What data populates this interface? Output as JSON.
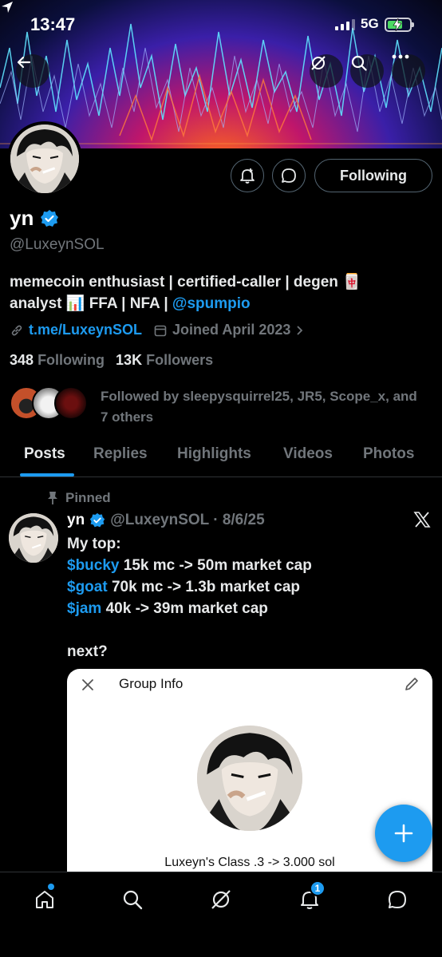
{
  "status_bar": {
    "time": "13:47",
    "network": "5G"
  },
  "profile": {
    "name": "yn",
    "handle": "@LuxeynSOL",
    "bio_line1": "memecoin enthusiast | certified-caller | degen 🀄",
    "bio_line2_prefix": "analyst 📊 FFA | NFA | ",
    "bio_mention": "@spumpio",
    "website": "t.me/LuxeynSOL",
    "joined": "Joined April 2023",
    "following_count": "348",
    "following_label": "Following",
    "followers_count": "13K",
    "followers_label": "Followers",
    "followed_by": "Followed by sleepysquirrel25, JR5, Scope_x, and 7 others",
    "follow_button_label": "Following"
  },
  "tabs": [
    {
      "label": "Posts"
    },
    {
      "label": "Replies"
    },
    {
      "label": "Highlights"
    },
    {
      "label": "Videos"
    },
    {
      "label": "Photos"
    }
  ],
  "post": {
    "pinned_label": "Pinned",
    "author": "yn",
    "meta": "@LuxeynSOL · 8/6/25",
    "lines": [
      {
        "ticker": "",
        "text": "My top:"
      },
      {
        "ticker": "$bucky",
        "text": " 15k mc -> 50m market cap"
      },
      {
        "ticker": "$goat",
        "text": " 70k mc -> 1.3b market cap"
      },
      {
        "ticker": "$jam",
        "text": " 40k -> 39m market cap"
      },
      {
        "ticker": "",
        "text": ""
      },
      {
        "ticker": "",
        "text": "next?"
      }
    ],
    "card": {
      "title": "Group Info",
      "caption": "Luxeyn's Class .3 -> 3.000 sol"
    }
  },
  "bottom_nav": {
    "notifications_badge": "1"
  },
  "colors": {
    "accent": "#1d9bf0",
    "muted": "#71767b",
    "text": "#e7e9ea",
    "background": "#000000"
  },
  "icons": [
    "back-arrow-icon",
    "grok-icon",
    "search-icon",
    "more-icon",
    "bell-plus-icon",
    "message-icon",
    "verified-icon",
    "link-icon",
    "calendar-icon",
    "chevron-right-icon",
    "pin-icon",
    "x-logo-icon",
    "close-icon",
    "pencil-icon",
    "plus-icon",
    "home-icon",
    "notifications-icon",
    "chat-icon"
  ]
}
